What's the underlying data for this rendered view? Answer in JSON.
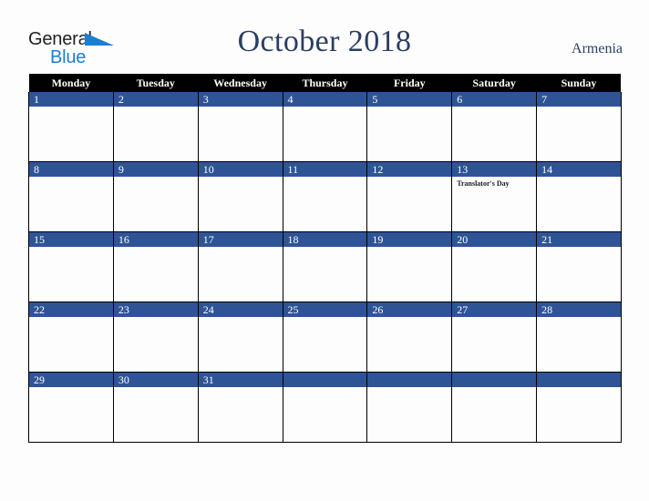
{
  "brand": {
    "name_line1": "General",
    "name_line2": "Blue",
    "flag_icon": "triangle-flag-icon",
    "color_dark": "#231f20",
    "color_blue": "#1b7fd4"
  },
  "header": {
    "title": "October 2018",
    "country": "Armenia",
    "title_color": "#2b3e63"
  },
  "theme": {
    "header_row_bg": "#000000",
    "header_row_text": "#ffffff",
    "day_band_bg": "#2f5496",
    "day_band_text": "#ffffff",
    "cell_bg": "#fdfdfd",
    "grid_line": "#000000",
    "page_bg": "#fdfdfd"
  },
  "calendar": {
    "month": "October",
    "year": "2018",
    "weekday_headers": [
      "Monday",
      "Tuesday",
      "Wednesday",
      "Thursday",
      "Friday",
      "Saturday",
      "Sunday"
    ],
    "weeks": [
      [
        {
          "day": "1",
          "event": ""
        },
        {
          "day": "2",
          "event": ""
        },
        {
          "day": "3",
          "event": ""
        },
        {
          "day": "4",
          "event": ""
        },
        {
          "day": "5",
          "event": ""
        },
        {
          "day": "6",
          "event": ""
        },
        {
          "day": "7",
          "event": ""
        }
      ],
      [
        {
          "day": "8",
          "event": ""
        },
        {
          "day": "9",
          "event": ""
        },
        {
          "day": "10",
          "event": ""
        },
        {
          "day": "11",
          "event": ""
        },
        {
          "day": "12",
          "event": ""
        },
        {
          "day": "13",
          "event": "Translator's Day"
        },
        {
          "day": "14",
          "event": ""
        }
      ],
      [
        {
          "day": "15",
          "event": ""
        },
        {
          "day": "16",
          "event": ""
        },
        {
          "day": "17",
          "event": ""
        },
        {
          "day": "18",
          "event": ""
        },
        {
          "day": "19",
          "event": ""
        },
        {
          "day": "20",
          "event": ""
        },
        {
          "day": "21",
          "event": ""
        }
      ],
      [
        {
          "day": "22",
          "event": ""
        },
        {
          "day": "23",
          "event": ""
        },
        {
          "day": "24",
          "event": ""
        },
        {
          "day": "25",
          "event": ""
        },
        {
          "day": "26",
          "event": ""
        },
        {
          "day": "27",
          "event": ""
        },
        {
          "day": "28",
          "event": ""
        }
      ],
      [
        {
          "day": "29",
          "event": ""
        },
        {
          "day": "30",
          "event": ""
        },
        {
          "day": "31",
          "event": ""
        },
        {
          "day": "",
          "event": ""
        },
        {
          "day": "",
          "event": ""
        },
        {
          "day": "",
          "event": ""
        },
        {
          "day": "",
          "event": ""
        }
      ]
    ]
  }
}
